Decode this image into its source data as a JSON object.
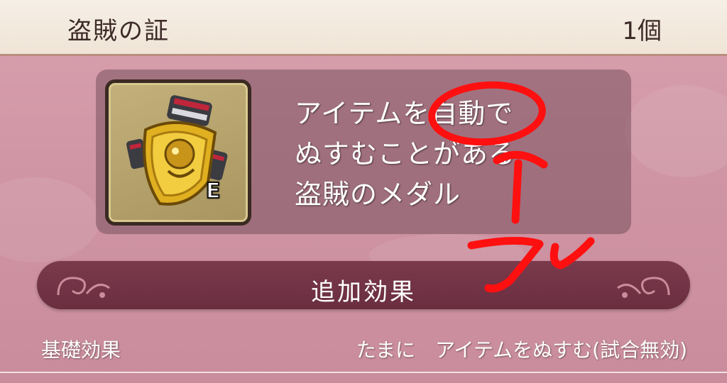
{
  "header": {
    "title": "盗賊の証",
    "count": "1個"
  },
  "item": {
    "icon": "thief-medal-icon",
    "equip_badge": "E",
    "description_lines": [
      "アイテムを自動で",
      "ぬすむことがある",
      "盗賊のメダル"
    ]
  },
  "section": {
    "title": "追加効果"
  },
  "effect": {
    "label": "基礎効果",
    "value": "たまに　アイテムをぬすむ(試合無効)"
  },
  "annotation": {
    "text": "コレ",
    "color": "#ff1010"
  },
  "colors": {
    "header_bg": "#f3eadf",
    "body_bg": "#d29aa9",
    "section_bar": "#73344a",
    "panel": "#8a5a66"
  }
}
